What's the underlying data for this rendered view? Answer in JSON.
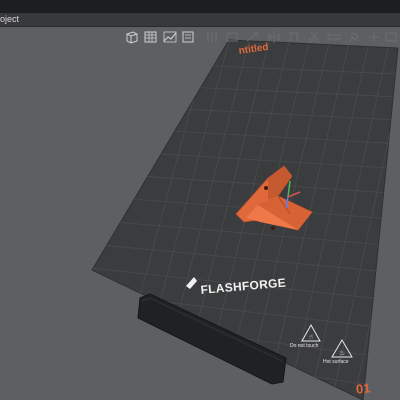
{
  "menubar": {
    "text": "oject"
  },
  "toolbar": {
    "icons": [
      "cube-view-icon",
      "grid-view-icon",
      "auto-arrange-icon",
      "layer-view-icon"
    ]
  },
  "plate": {
    "name": "ntitled",
    "number": "01",
    "brand": "FLASHFORGE",
    "bed_color": "#3b3c3e",
    "grid_color": "#4d4e51",
    "model_color": "#e0683b"
  },
  "warnings": {
    "left_sign": "Do not touch",
    "right_sign": "Hot surface"
  }
}
